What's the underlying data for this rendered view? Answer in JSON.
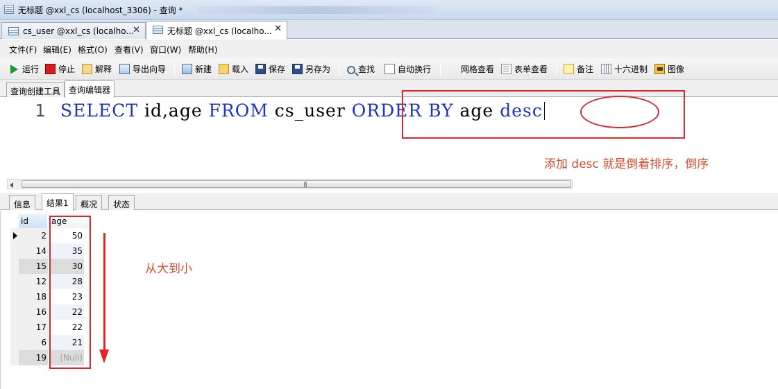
{
  "window": {
    "title": "无标题 @xxl_cs (localhost_3306) - 查询 *"
  },
  "doc_tabs": [
    {
      "label": "cs_user @xxl_cs (localho...",
      "close": "✕"
    },
    {
      "label": "无标题 @xxl_cs (localho...",
      "close": "✕"
    }
  ],
  "menu": [
    "文件(F)",
    "编辑(E)",
    "格式(O)",
    "查看(V)",
    "窗口(W)",
    "帮助(H)"
  ],
  "toolbar": {
    "run": "运行",
    "stop": "停止",
    "explain": "解释",
    "export_wizard": "导出向导",
    "new": "新建",
    "load": "载入",
    "save": "保存",
    "save_as": "另存为",
    "find": "查找",
    "word_wrap": "自动换行",
    "grid_view": "网格查看",
    "form_view": "表单查看",
    "note": "备注",
    "hex": "十六进制",
    "image": "图像"
  },
  "sub_tabs": [
    "查询创建工具",
    "查询编辑器"
  ],
  "editor": {
    "line_number": "1",
    "kw_select": "SELECT",
    "cols": " id,age ",
    "kw_from": "FROM",
    "table": " cs_user ",
    "kw_order": "ORDER",
    "kw_by": "BY",
    "order_col": " age ",
    "kw_desc": "desc"
  },
  "annotations": {
    "desc_note": "添加 desc 就是倒着排序，倒序",
    "order_note": "从大到小"
  },
  "scrollbar": {
    "grip": "|||"
  },
  "result_tabs": [
    "信息",
    "结果1",
    "概况",
    "状态"
  ],
  "result": {
    "columns": [
      "id",
      "age"
    ],
    "rows": [
      {
        "id": "2",
        "age": "50"
      },
      {
        "id": "14",
        "age": "35"
      },
      {
        "id": "15",
        "age": "30"
      },
      {
        "id": "12",
        "age": "28"
      },
      {
        "id": "18",
        "age": "23"
      },
      {
        "id": "16",
        "age": "22"
      },
      {
        "id": "17",
        "age": "22"
      },
      {
        "id": "6",
        "age": "21"
      },
      {
        "id": "19",
        "age": "(Null)"
      }
    ]
  },
  "colors": {
    "keyword": "#1d33c8",
    "annotation": "#e6222a",
    "annotation_text": "#e34a2e"
  }
}
